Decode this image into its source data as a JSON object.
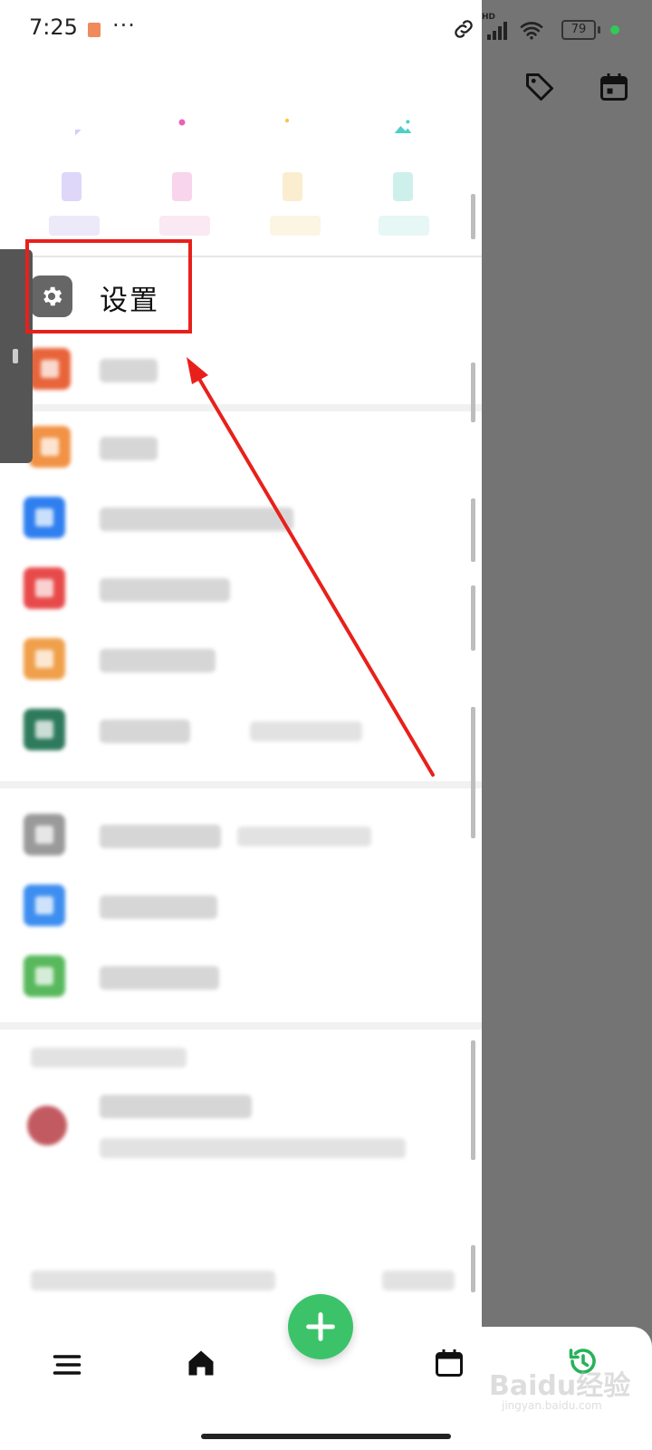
{
  "status_bar": {
    "time": "7:25",
    "more": "···",
    "network_label": "HD",
    "battery_level": "79"
  },
  "quick_actions": [
    {
      "icon": "note-icon",
      "color": "#9b7cf0"
    },
    {
      "icon": "location-pin-icon",
      "color": "#ee5fba"
    },
    {
      "icon": "tag-icon",
      "color": "#f9c442"
    },
    {
      "icon": "image-icon",
      "color": "#4fcfc7"
    }
  ],
  "drawer_menu": {
    "settings_label": "设置"
  },
  "colors": {
    "highlight": "#e8201b",
    "fab": "#3cc36a",
    "backdrop": "#747474"
  },
  "watermark": {
    "logo": "Baidu经验",
    "url": "jingyan.baidu.com"
  }
}
